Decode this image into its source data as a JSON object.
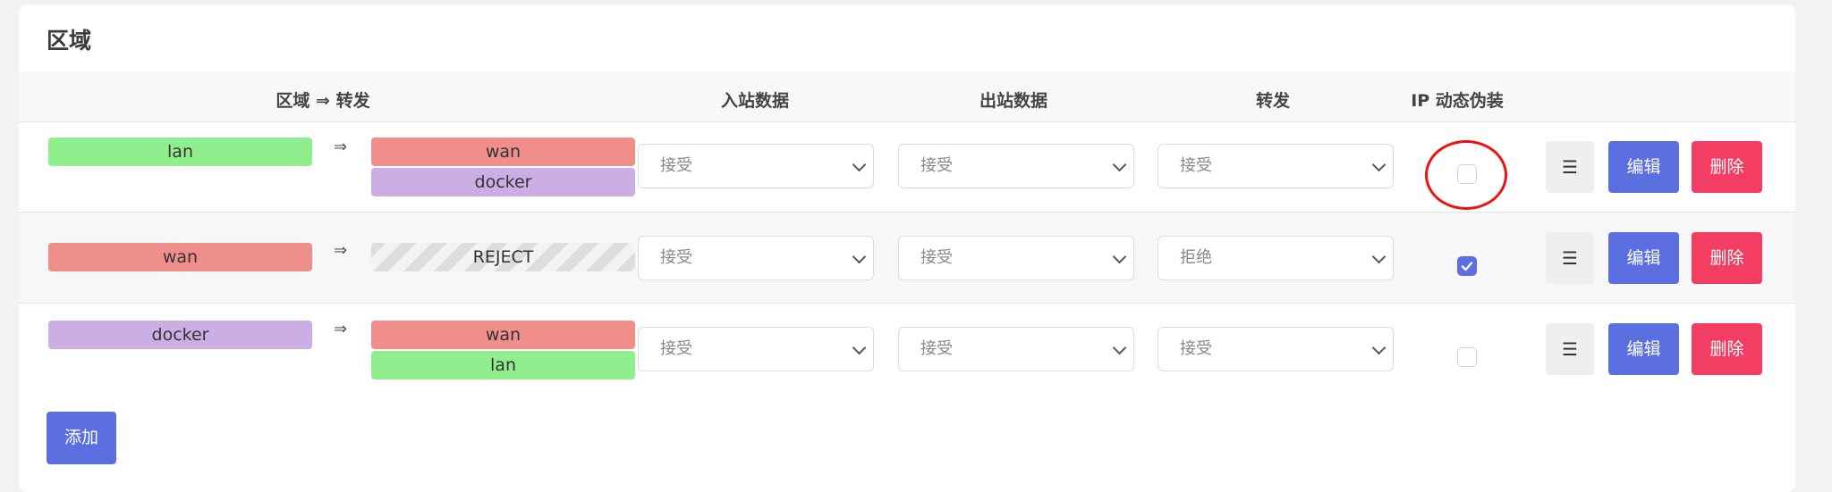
{
  "title": "区域",
  "headers": {
    "zone_forward": "区域 ⇒ 转发",
    "inbound": "入站数据",
    "outbound": "出站数据",
    "forward": "转发",
    "masquerade": "IP 动态伪装"
  },
  "colors": {
    "lan": "#90ee8f",
    "wan": "#f08e8c",
    "docker": "#cbaee4",
    "accent": "#5b6fe0",
    "danger": "#f33d63"
  },
  "rows": [
    {
      "zone": "lan",
      "arrow": "⇒",
      "forwards": [
        "wan",
        "docker"
      ],
      "inbound": "接受",
      "outbound": "接受",
      "forward": "接受",
      "masquerade": false
    },
    {
      "zone": "wan",
      "arrow": "⇒",
      "forwards": [
        "REJECT"
      ],
      "inbound": "接受",
      "outbound": "接受",
      "forward": "拒绝",
      "masquerade": true
    },
    {
      "zone": "docker",
      "arrow": "⇒",
      "forwards": [
        "wan",
        "lan"
      ],
      "inbound": "接受",
      "outbound": "接受",
      "forward": "接受",
      "masquerade": false
    }
  ],
  "buttons": {
    "menu": "☰",
    "edit": "编辑",
    "delete": "删除",
    "add": "添加"
  }
}
